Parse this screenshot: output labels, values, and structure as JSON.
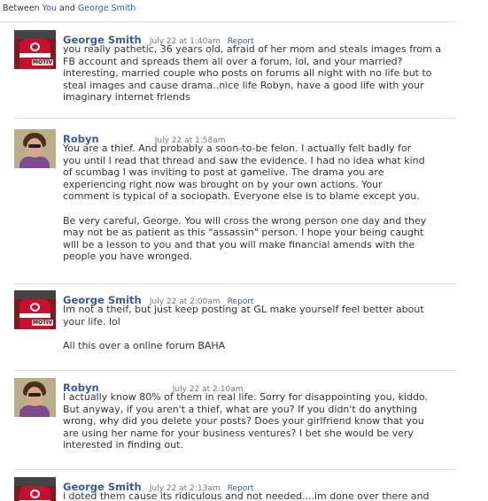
{
  "header": {
    "prefix": "Between",
    "you": "You",
    "and": "and",
    "other": "George Smith"
  },
  "messages": [
    {
      "sender": "George Smith",
      "time": "July 22 at 1:40am",
      "report": "Report",
      "paragraphs": [
        "you really pathetic, 36 years old, afraid of her mom and steals images from a\nFB account and spreads them all over a forum, lol, and your married?\ninteresting, married couple who posts on forums all night with no life but to\nsteal images and cause drama..nice life Robyn, have a good life with your\nimaginary internet friends"
      ]
    },
    {
      "sender": "Robyn",
      "time": "July 22 at 1:58am",
      "report": "",
      "paragraphs": [
        "You are a thief. And probably a soon-to-be felon. I actually felt badly for\nyou until I read that thread and saw the evidence. I had no idea what kind\nof scumbag I was inviting to post at gamelive. The drama you are\nexperiencing right now was brought on by your own actions. Your\ncomment is typical of a sociopath. Everyone else is to blame except you.",
        "Be very careful, George. You will cross the wrong person one day and they\nmay not be as patient as this \"assassin\" person. I hope your being caught\nwill be a lesson to you and that you will make financial amends with the\npeople you have wronged."
      ]
    },
    {
      "sender": "George Smith",
      "time": "July 22 at 2:00am",
      "report": "Report",
      "paragraphs": [
        "Im not a theif, but just keep posting at GL make yourself feel better about\nyour life. lol",
        "All this over a online forum BAHA"
      ]
    },
    {
      "sender": "Robyn",
      "time": "July 22 at 2:10am",
      "report": "",
      "paragraphs": [
        "I actually know 80% of them in real life. Sorry for disappointing you, kiddo.\nBut anyway, if you aren't a thief, what are you? If you didn't do anything\nwrong, why did you delete your posts? Does your girlfriend know that you\nare using her name for your business ventures? I bet she would be very\ninterested in finding out."
      ]
    },
    {
      "sender": "George Smith",
      "time": "July 22 at 2:13am",
      "report": "Report",
      "paragraphs": [
        "i doted them cause its ridiculous and not needed....im done over there and"
      ]
    }
  ],
  "colors": {
    "link": "#3b5998",
    "divider": "#d8dfea",
    "text": "#333333",
    "meta": "#777777"
  }
}
